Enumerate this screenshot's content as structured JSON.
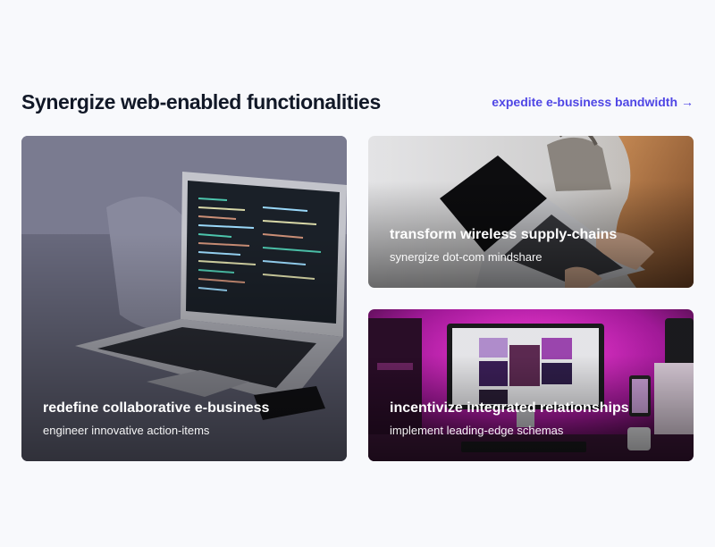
{
  "section": {
    "title": "Synergize web-enabled functionalities",
    "link_label": "expedite e-business bandwidth",
    "link_arrow": "→"
  },
  "cards": [
    {
      "title": "redefine collaborative e-business",
      "subtitle": "engineer innovative action-items",
      "image": "laptop-on-couch-photo"
    },
    {
      "title": "transform wireless supply-chains",
      "subtitle": "synergize dot-com mindshare",
      "image": "person-using-laptop-photo"
    },
    {
      "title": "incentivize integrated relationships",
      "subtitle": "implement leading-edge schemas",
      "image": "desk-monitor-pink-light-photo"
    }
  ],
  "colors": {
    "background": "#f8f9fc",
    "heading": "#111827",
    "accent": "#4f46e5"
  }
}
